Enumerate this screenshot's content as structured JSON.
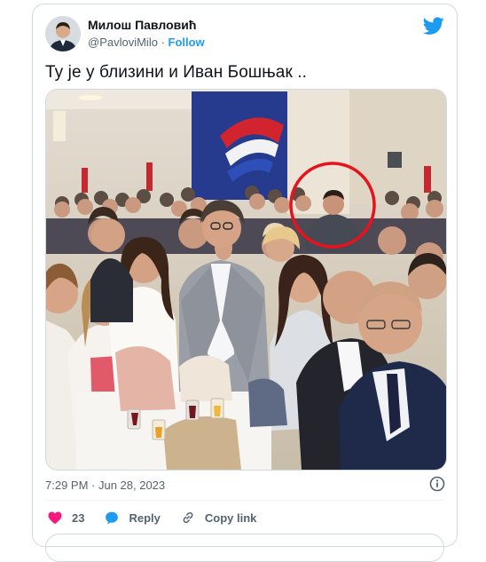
{
  "author": {
    "display_name": "Милош Павловић",
    "handle": "@PavloviMilo",
    "separator": " · ",
    "follow_label": "Follow"
  },
  "tweet": {
    "text": "Ту је у близини и Иван Бошњак ..",
    "timestamp": "7:29 PM · Jun 28, 2023"
  },
  "actions": {
    "like_count": "23",
    "reply_label": "Reply",
    "copy_link_label": "Copy link"
  },
  "colors": {
    "brand_blue": "#1d9bf0",
    "like_pink": "#f91880",
    "muted": "#536471",
    "highlight_circle": "#e8121c"
  },
  "icons": [
    "bird-icon",
    "info-icon",
    "heart-icon",
    "reply-icon",
    "link-icon"
  ]
}
